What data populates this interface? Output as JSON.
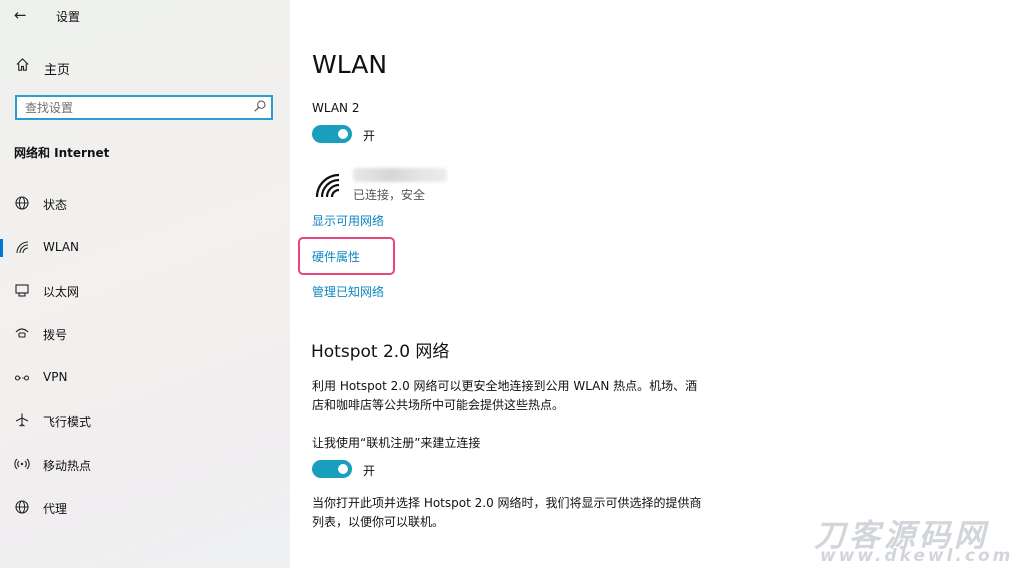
{
  "app": {
    "title": "设置",
    "back_icon": "back-arrow-icon"
  },
  "sidebar": {
    "home": {
      "label": "主页",
      "icon": "home-icon"
    },
    "search": {
      "placeholder": "查找设置",
      "icon": "search-icon"
    },
    "section_title": "网络和 Internet",
    "items": [
      {
        "label": "状态",
        "icon": "globe-status-icon",
        "selected": false
      },
      {
        "label": "WLAN",
        "icon": "wifi-icon",
        "selected": true
      },
      {
        "label": "以太网",
        "icon": "ethernet-icon",
        "selected": false
      },
      {
        "label": "拨号",
        "icon": "dialup-icon",
        "selected": false
      },
      {
        "label": "VPN",
        "icon": "vpn-icon",
        "selected": false
      },
      {
        "label": "飞行模式",
        "icon": "airplane-icon",
        "selected": false
      },
      {
        "label": "移动热点",
        "icon": "hotspot-icon",
        "selected": false
      },
      {
        "label": "代理",
        "icon": "globe-proxy-icon",
        "selected": false
      }
    ]
  },
  "main": {
    "title": "WLAN",
    "adapter": "WLAN 2",
    "wlan_toggle": {
      "state": "开",
      "on": true
    },
    "network": {
      "status": "已连接，安全",
      "icon": "wifi-signal-icon"
    },
    "links": {
      "show_networks": "显示可用网络",
      "hardware_properties": "硬件属性",
      "manage_networks": "管理已知网络"
    },
    "hotspot": {
      "heading": "Hotspot 2.0 网络",
      "description_line1": "利用 Hotspot 2.0 网络可以更安全地连接到公用 WLAN 热点。机场、酒",
      "description_line2": "店和咖啡店等公共场所中可能会提供这些热点。",
      "toggle_caption": "让我使用“联机注册”来建立连接",
      "toggle": {
        "state": "开",
        "on": true
      },
      "note_line1": "当你打开此项并选择 Hotspot 2.0 网络时，我们将显示可供选择的提供商",
      "note_line2": "列表，以便你可以联机。"
    }
  },
  "watermark": {
    "top": "刀客源码网",
    "bottom": "www.dkewl.com"
  },
  "colors": {
    "accent": "#1a9ebe",
    "link": "#0f86c0",
    "highlight": "#e8467a",
    "search_border": "#2a9fc9"
  }
}
